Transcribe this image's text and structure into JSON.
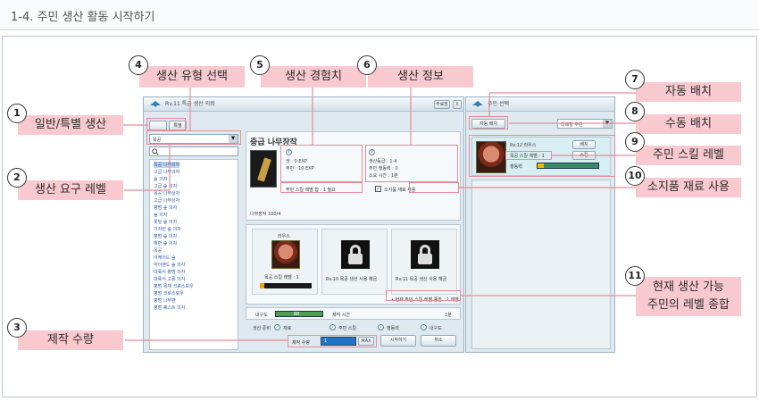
{
  "page": {
    "title": "1-4. 주민 생산 활동 시작하기"
  },
  "main_window": {
    "title": "Rv.11 특급 생산 의뢰",
    "header_buttons": [
      "무료장",
      "X"
    ],
    "type_buttons": [
      "",
      "특별"
    ],
    "dropdown_value": "목공",
    "list_items": [
      "목공 나무의자",
      "고급 나무의자",
      "숲 의자",
      "고급 숲 의자",
      "목공 나무상자",
      "고급 나무상자",
      "평범 숲 의자",
      "숲 의자",
      "꽃잎 숲 의자",
      "가지런 숲 의자",
      "평범 숲 의자",
      "해변 숲 의자",
      "목공",
      "아케이드 숲",
      "하이랜드 숲 의자",
      "대륙식 평범 의자",
      "대륙식 고풍 의자",
      "평범 목재 크로스보우",
      "평범 크로스보우",
      "평범 나무판",
      "평범 퀘스트 의자"
    ],
    "item_name": "중급 나무장작",
    "stats_left": [
      "생 : 0 EXP",
      "주민 : 10 EXP"
    ],
    "stats_right": [
      "생산등급 : 1-4",
      "주민 행동력 : 0",
      "소요 시간 : 1분"
    ],
    "item_sub": "나무장작 100/4",
    "req_level": "주민 스킬 레벨 합 : 1 필요",
    "use_inventory": "소지품 재료 사용",
    "slot1_name": "라우스",
    "slot1_skill": "목공 스킬 레벨 : 1",
    "slot2_label": "Rv.10 목공 생산 사용 해금",
    "slot3_label": "Rv.11 목공 생산 사용 해금",
    "total_level_note": "• 현재 주민 스킬 레벨 종합 : 1 레벨",
    "durability_label": "내구도",
    "durability_value": "88",
    "time_label": "제작 시간",
    "time_value": "1분",
    "production_label": "생산 준비",
    "checks": [
      "재료",
      "주민 스킬",
      "행동력",
      "내구도"
    ],
    "qty_label": "제작 수량",
    "qty_value": "1",
    "max_label": "MAX",
    "start_button": "시작하기",
    "cancel_button": "취소"
  },
  "side_window": {
    "title": "주민 선택",
    "auto_button": "자동 배치",
    "dropdown": "미배정 주민",
    "char_name": "Rv.12  라우스",
    "skill": "목공 스킬 레벨 : 1",
    "action": "행동력",
    "btn1": "배치",
    "btn2": "스킬"
  },
  "callouts": [
    {
      "num": "1",
      "text": "일반/특별 생산"
    },
    {
      "num": "2",
      "text": "생산 요구 레벨"
    },
    {
      "num": "3",
      "text": "제작 수량"
    },
    {
      "num": "4",
      "text": "생산 유형 선택"
    },
    {
      "num": "5",
      "text": "생산 경험치"
    },
    {
      "num": "6",
      "text": "생산 정보"
    },
    {
      "num": "7",
      "text": "자동 배치"
    },
    {
      "num": "8",
      "text": "수동 배치"
    },
    {
      "num": "9",
      "text": "주민 스킬 레벨"
    },
    {
      "num": "10",
      "text": "소지품 재료 사용"
    },
    {
      "num": "11",
      "text": "현재 생산 가능",
      "text2": "주민의 레벨 종합"
    }
  ],
  "colors": {
    "callout_bg": "#f8c9cf",
    "callout_line": "#e88c98",
    "window_bg": "#dfe9f0"
  }
}
